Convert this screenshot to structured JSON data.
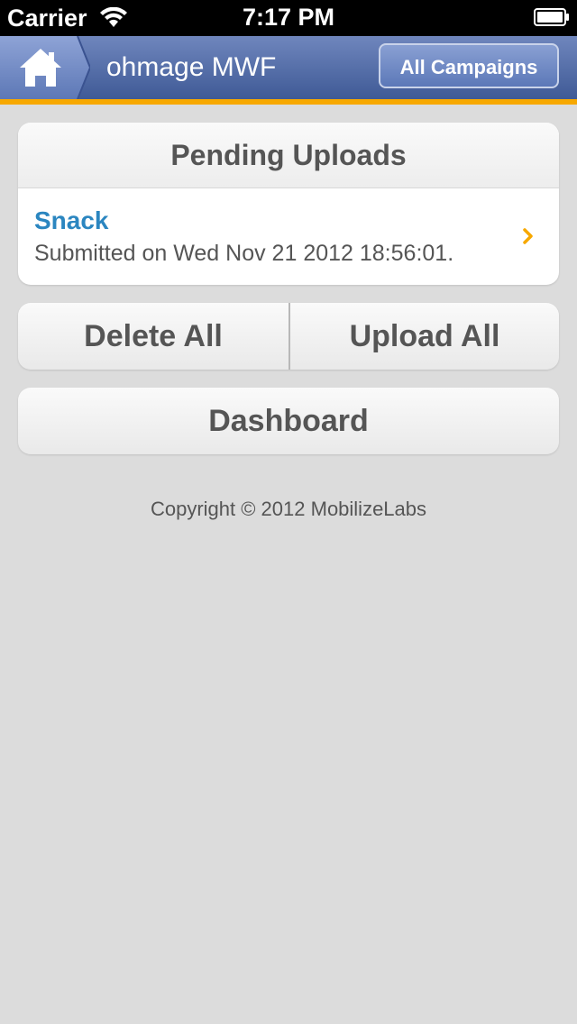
{
  "status_bar": {
    "carrier": "Carrier",
    "time": "7:17 PM",
    "icons": [
      "wifi-icon",
      "battery-icon"
    ]
  },
  "nav": {
    "home_icon": "home-icon",
    "title": "ohmage MWF",
    "campaigns_label": "All Campaigns",
    "accent_color": "#f7a800",
    "bar_color": "#4a64a0"
  },
  "pending": {
    "header": "Pending Uploads",
    "items": [
      {
        "title": "Snack",
        "subtitle": "Submitted on Wed Nov 21 2012 18:56:01.",
        "icon": "chevron-right-icon"
      }
    ]
  },
  "actions": {
    "delete_all": "Delete All",
    "upload_all": "Upload All",
    "dashboard": "Dashboard"
  },
  "footer": {
    "copyright": "Copyright © 2012 MobilizeLabs"
  }
}
